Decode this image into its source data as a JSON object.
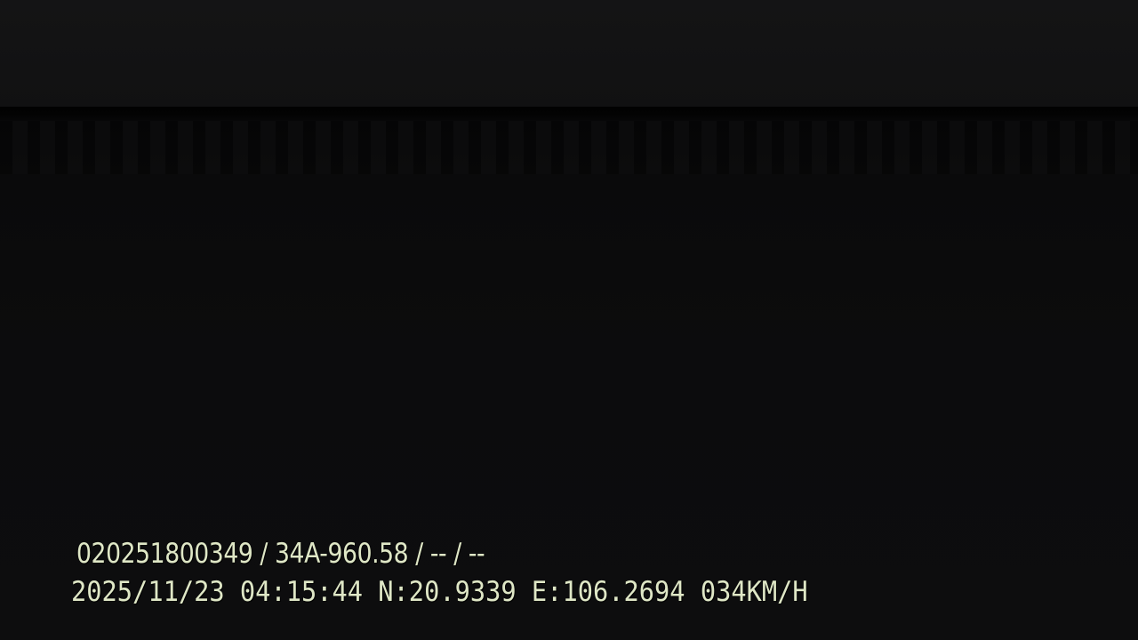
{
  "camera_overlay": {
    "device_line": "020251800349 / 34A-960.58 / -- / --",
    "telemetry_line": "2025/11/23 04:15:44 N:20.9339 E:106.2694 034KM/H",
    "text_color": "#dfe7c6",
    "background_color": "#0b0b0c"
  }
}
